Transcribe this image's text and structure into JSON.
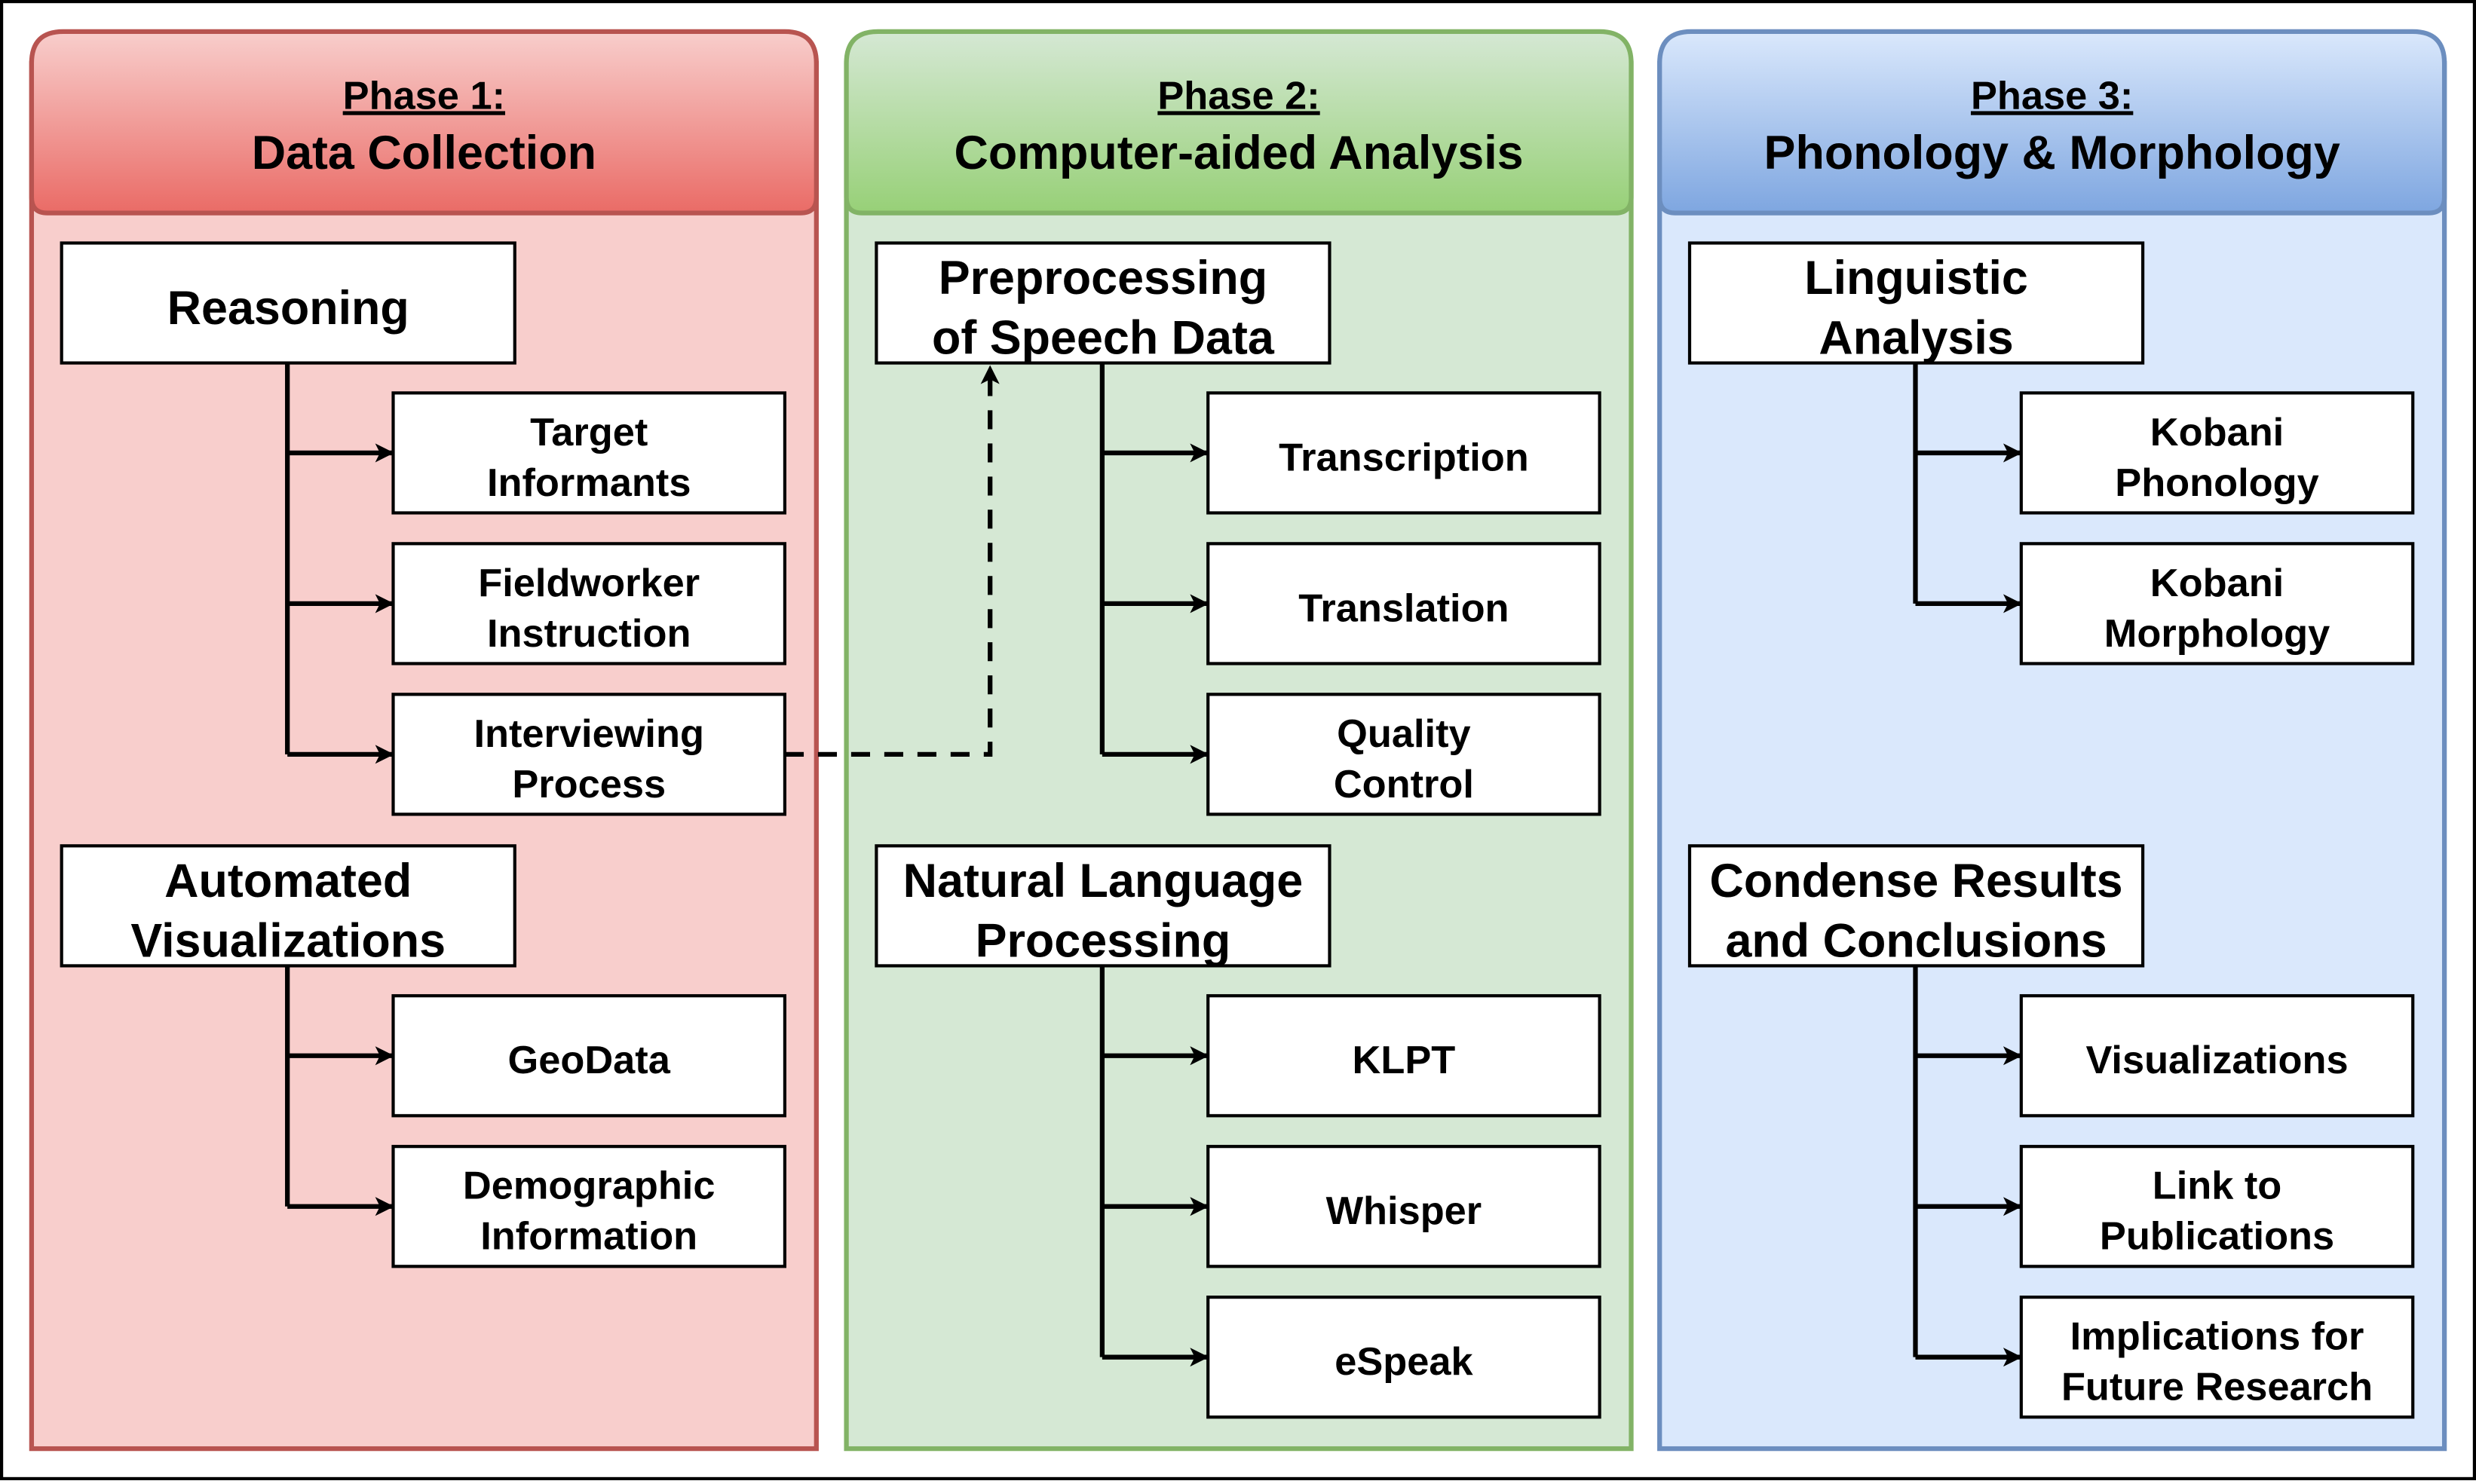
{
  "diagram": {
    "phases": [
      {
        "label": "Phase 1:",
        "title": "Data Collection",
        "colors": {
          "border": "#b85450",
          "fill": "#f8cecc",
          "header_top": "#f8cecc",
          "header_bottom": "#ea6b66"
        },
        "groups": [
          {
            "title_lines": [
              "Reasoning"
            ],
            "children": [
              [
                "Target",
                "Informants"
              ],
              [
                "Fieldworker",
                "Instruction"
              ],
              [
                "Interviewing",
                "Process"
              ]
            ]
          },
          {
            "title_lines": [
              "Automated",
              "Visualizations"
            ],
            "children": [
              [
                "GeoData"
              ],
              [
                "Demographic",
                "Information"
              ]
            ]
          }
        ]
      },
      {
        "label": "Phase 2:",
        "title": "Computer-aided Analysis",
        "colors": {
          "border": "#82b366",
          "fill": "#d5e8d4",
          "header_top": "#d5e8d4",
          "header_bottom": "#97d077"
        },
        "groups": [
          {
            "title_lines": [
              "Preprocessing",
              "of Speech Data"
            ],
            "children": [
              [
                "Transcription"
              ],
              [
                "Translation"
              ],
              [
                "Quality",
                "Control"
              ]
            ]
          },
          {
            "title_lines": [
              "Natural Language",
              "Processing"
            ],
            "children": [
              [
                "KLPT"
              ],
              [
                "Whisper"
              ],
              [
                "eSpeak"
              ]
            ]
          }
        ]
      },
      {
        "label": "Phase 3:",
        "title": "Phonology & Morphology",
        "colors": {
          "border": "#6c8ebf",
          "fill": "#dae8fc",
          "header_top": "#dae8fc",
          "header_bottom": "#7ea6e0"
        },
        "groups": [
          {
            "title_lines": [
              "Linguistic",
              "Analysis"
            ],
            "children": [
              [
                "Kobani",
                "Phonology"
              ],
              [
                "Kobani",
                "Morphology"
              ]
            ]
          },
          {
            "title_lines": [
              "Condense Results",
              "and Conclusions"
            ],
            "children": [
              [
                "Visualizations"
              ],
              [
                "Link to",
                "Publications"
              ],
              [
                "Implications for",
                "Future Research"
              ]
            ]
          }
        ]
      }
    ],
    "dashed_link": {
      "from": "Interviewing Process",
      "to": "Preprocessing of Speech Data",
      "style": "dashed"
    }
  }
}
